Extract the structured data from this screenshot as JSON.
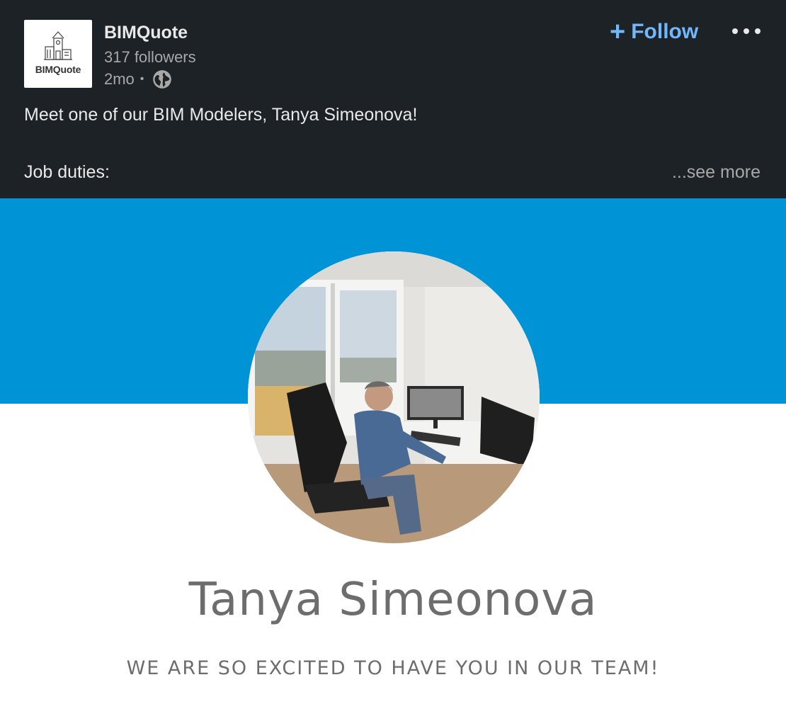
{
  "company": {
    "logo_text": "BIMQuote",
    "name": "BIMQuote",
    "followers": "317 followers",
    "age": "2mo",
    "separator": "•"
  },
  "actions": {
    "follow_plus": "+",
    "follow_label": "Follow"
  },
  "post": {
    "text_line_1": "Meet one of our BIM Modelers, Tanya Simeonova!",
    "text_line_2": "Job duties:",
    "see_more": "...see more"
  },
  "image": {
    "person_name": "Tanya Simeonova",
    "tagline": "WE ARE SO EXCITED TO HAVE YOU IN OUR TEAM!"
  },
  "colors": {
    "background": "#1d2226",
    "accent_blue": "#71b7fb",
    "banner_blue": "#0093d6",
    "text_primary": "#e9e9e9",
    "text_secondary": "#a8a8a8"
  },
  "icons": {
    "visibility": "globe-icon",
    "more": "more-horizontal-icon",
    "logo_graphic": "building-icon"
  }
}
